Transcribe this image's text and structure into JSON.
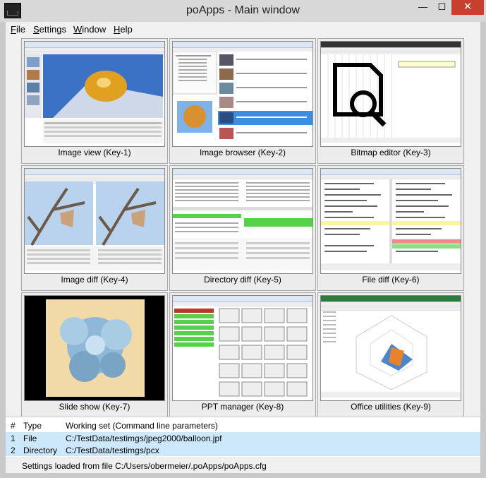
{
  "window": {
    "title": "poApps - Main window",
    "min_glyph": "—",
    "max_glyph": "☐",
    "close_glyph": "✕"
  },
  "menu": [
    {
      "label": "File",
      "first": "F",
      "rest": "ile"
    },
    {
      "label": "Settings",
      "first": "S",
      "rest": "ettings"
    },
    {
      "label": "Window",
      "first": "W",
      "rest": "indow"
    },
    {
      "label": "Help",
      "first": "H",
      "rest": "elp"
    }
  ],
  "tiles": [
    {
      "caption": "Image view (Key-1)"
    },
    {
      "caption": "Image browser (Key-2)"
    },
    {
      "caption": "Bitmap editor (Key-3)"
    },
    {
      "caption": "Image diff (Key-4)"
    },
    {
      "caption": "Directory diff (Key-5)"
    },
    {
      "caption": "File diff (Key-6)"
    },
    {
      "caption": "Slide show (Key-7)"
    },
    {
      "caption": "PPT manager (Key-8)"
    },
    {
      "caption": "Office utilities (Key-9)"
    }
  ],
  "working_set": {
    "columns": [
      "#",
      "Type",
      "Working set (Command line parameters)"
    ],
    "rows": [
      {
        "num": "1",
        "type": "File",
        "path": "C:/TestData/testimgs/jpeg2000/balloon.jpf"
      },
      {
        "num": "2",
        "type": "Directory",
        "path": "C:/TestData/testimgs/pcx"
      }
    ]
  },
  "status": "Settings loaded from file C:/Users/obermeier/.poApps/poApps.cfg",
  "colors": {
    "close_button": "#c7402e",
    "selected_row": "#cde8fb",
    "diff_green": "#57d14a",
    "ppt_red": "#c0342c"
  }
}
